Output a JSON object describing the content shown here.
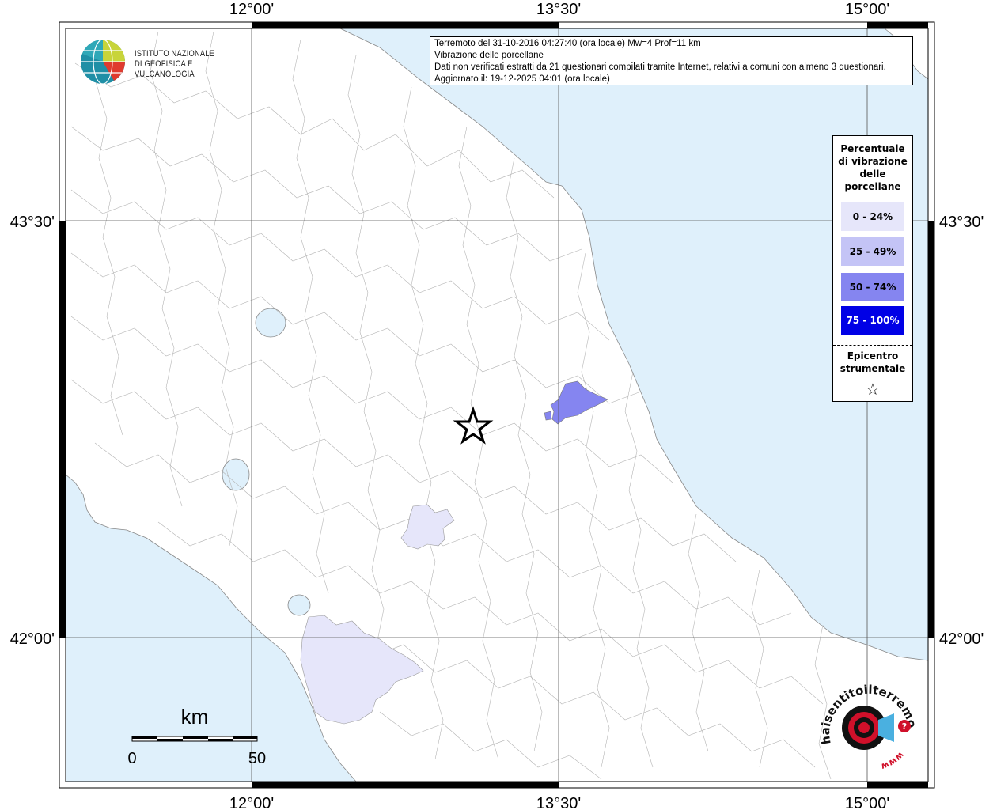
{
  "map": {
    "lon_labels": [
      "12°00'",
      "13°30'",
      "15°00'"
    ],
    "lat_labels": [
      "43°30'",
      "42°00'"
    ],
    "scale_bar": {
      "unit": "km",
      "start": "0",
      "end": "50"
    }
  },
  "info": {
    "line1": "Terremoto del 31-10-2016 04:27:40 (ora locale) Mw=4 Prof=11 km",
    "line2": "Vibrazione delle porcellane",
    "line3": "Dati non verificati estratti da 21 questionari compilati tramite Internet, relativi a comuni con almeno 3 questionari.",
    "line4": "Aggiornato il: 19-12-2025 04:01 (ora locale)"
  },
  "legend": {
    "title_lines": [
      "Percentuale",
      "di vibrazione",
      "delle",
      "porcellane"
    ],
    "items": [
      {
        "label": "0 - 24%",
        "color": "#e6e6fa"
      },
      {
        "label": "25 - 49%",
        "color": "#c4c4f6"
      },
      {
        "label": "50 - 74%",
        "color": "#8585f0"
      },
      {
        "label": "75 - 100%",
        "color": "#0000e6"
      }
    ],
    "epicentro_lines": [
      "Epicentro",
      "strumentale"
    ]
  },
  "logo": {
    "line1": "ISTITUTO NAZIONALE",
    "line2": "DI GEOFISICA E VULCANOLOGIA"
  },
  "badge": {
    "text": "haisentitoilterremoto.it",
    "www": "www"
  },
  "colors": {
    "sea": "#dff0fb",
    "land": "#ffffff",
    "border_lines": "#aaaaaa",
    "grid": "#555555"
  }
}
